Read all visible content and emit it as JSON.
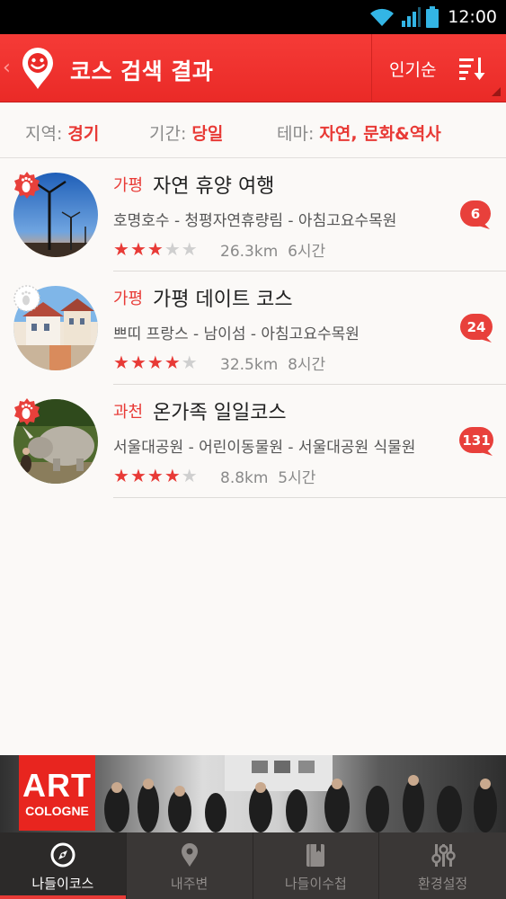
{
  "status_bar": {
    "time": "12:00"
  },
  "header": {
    "title": "코스 검색 결과",
    "sort_label": "인기순",
    "accent_color": "#ea2a27"
  },
  "filters": [
    {
      "key": "지역:",
      "value": "경기"
    },
    {
      "key": "기간:",
      "value": "당일"
    },
    {
      "key": "테마:",
      "value": "자연, 문화&역사"
    }
  ],
  "courses": [
    {
      "region": "가평",
      "title": "자연 휴양 여행",
      "route": "호명호수 - 청평자연휴량림 - 아침고요수목원",
      "rating": 3,
      "distance": "26.3km",
      "duration": "6시간",
      "comments": "6",
      "badge_style": "filled"
    },
    {
      "region": "가평",
      "title": "가평 데이트 코스",
      "route": "쁘띠 프랑스 - 남이섬 - 아침고요수목원",
      "rating": 4,
      "distance": "32.5km",
      "duration": "8시간",
      "comments": "24",
      "badge_style": "outline"
    },
    {
      "region": "과천",
      "title": "온가족 일일코스",
      "route": "서울대공원 - 어린이동물원 - 서울대공원 식물원",
      "rating": 4,
      "distance": "8.8km",
      "duration": "5시간",
      "comments": "131",
      "badge_style": "filled"
    }
  ],
  "banner": {
    "logo_main": "ART",
    "logo_sub": "COLOGNE"
  },
  "bottom_nav": [
    {
      "label": "나들이코스",
      "icon": "compass-icon",
      "active": true
    },
    {
      "label": "내주변",
      "icon": "location-pin-icon",
      "active": false
    },
    {
      "label": "나들이수첩",
      "icon": "notebook-icon",
      "active": false
    },
    {
      "label": "환경설정",
      "icon": "sliders-icon",
      "active": false
    }
  ]
}
